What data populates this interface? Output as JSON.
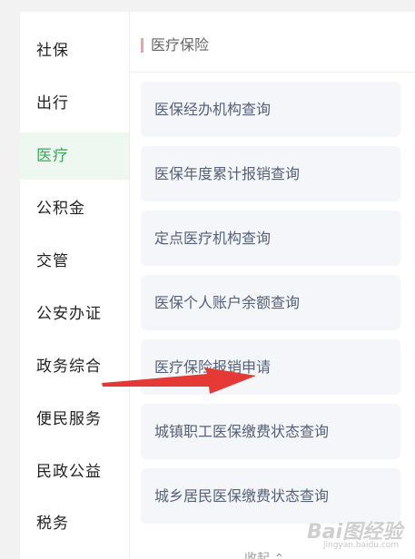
{
  "sidebar": {
    "items": [
      {
        "label": "社保",
        "active": false
      },
      {
        "label": "出行",
        "active": false
      },
      {
        "label": "医疗",
        "active": true
      },
      {
        "label": "公积金",
        "active": false
      },
      {
        "label": "交管",
        "active": false
      },
      {
        "label": "公安办证",
        "active": false
      },
      {
        "label": "政务综合",
        "active": false
      },
      {
        "label": "便民服务",
        "active": false
      },
      {
        "label": "民政公益",
        "active": false
      },
      {
        "label": "税务",
        "active": false
      }
    ]
  },
  "main": {
    "section_title": "医疗保险",
    "services": [
      {
        "label": "医保经办机构查询"
      },
      {
        "label": "医保年度累计报销查询"
      },
      {
        "label": "定点医疗机构查询"
      },
      {
        "label": "医保个人账户余额查询"
      },
      {
        "label": "医疗保险报销申请"
      },
      {
        "label": "城镇职工医保缴费状态查询"
      },
      {
        "label": "城乡居民医保缴费状态查询"
      }
    ],
    "collapse_label": "收起 ⌃"
  },
  "watermark": {
    "text": "Bai图经验",
    "sub": "jingyan.baidu.com"
  },
  "colors": {
    "accent": "#3aa85a",
    "active_bg": "#eef8f0",
    "card_bg": "#f4f6fa",
    "arrow": "#e53935"
  }
}
